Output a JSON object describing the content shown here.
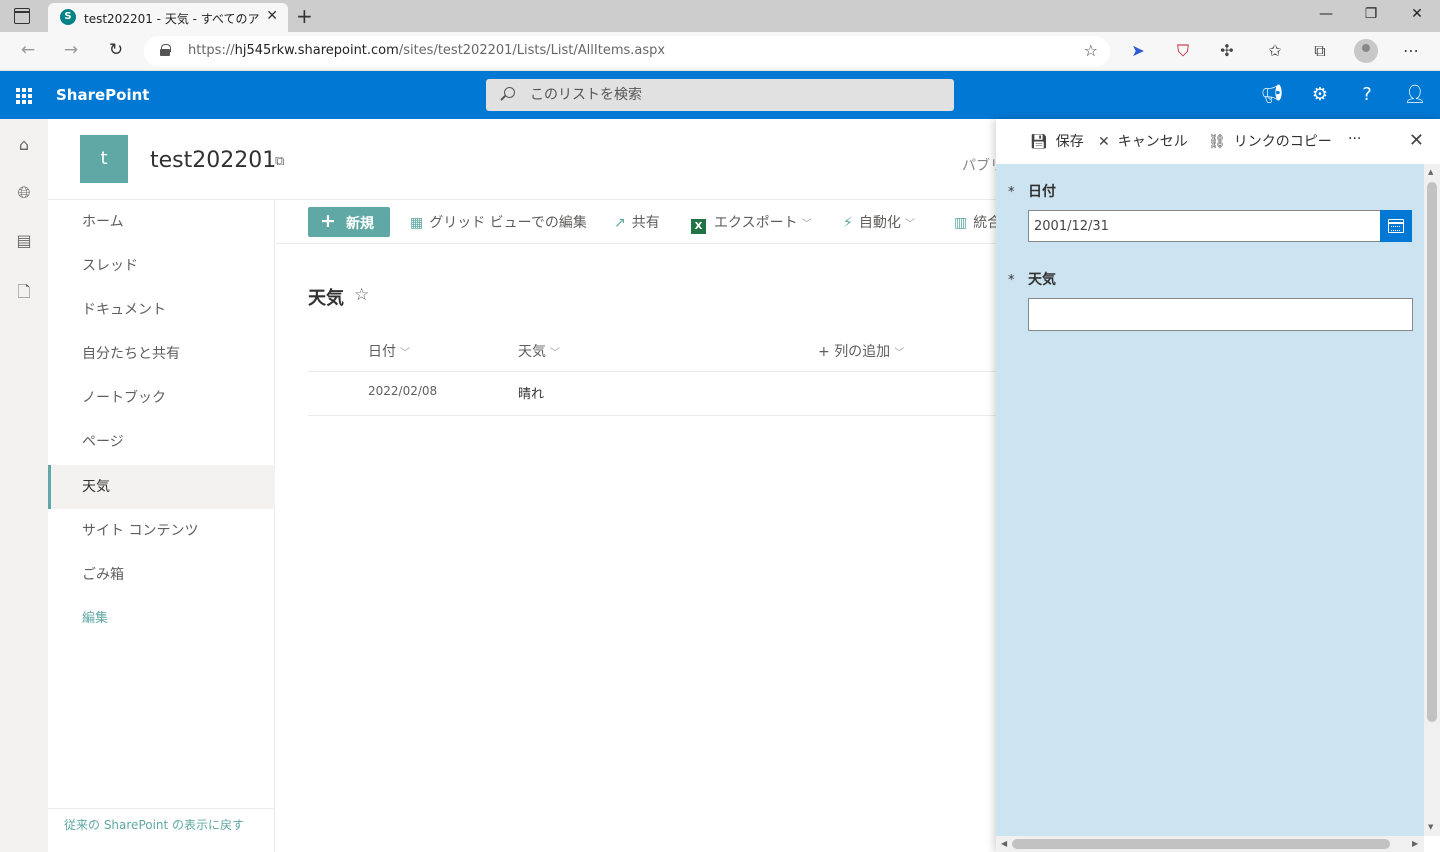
{
  "browser": {
    "tab_title": "test202201 - 天気 - すべてのアイテム",
    "favicon_letter": "S",
    "url_prefix": "https://",
    "url_host": "hj545rkw.sharepoint.com",
    "url_path": "/sites/test202201/Lists/List/AllItems.aspx"
  },
  "suite": {
    "brand": "SharePoint",
    "search_placeholder": "このリストを検索"
  },
  "site": {
    "logo_letter": "t",
    "title": "test202201",
    "privacy": "パブリ"
  },
  "leftnav": {
    "items": [
      {
        "label": "ホーム"
      },
      {
        "label": "スレッド"
      },
      {
        "label": "ドキュメント"
      },
      {
        "label": "自分たちと共有"
      },
      {
        "label": "ノートブック"
      },
      {
        "label": "ページ"
      },
      {
        "label": "天気"
      },
      {
        "label": "サイト コンテンツ"
      },
      {
        "label": "ごみ箱"
      }
    ],
    "edit": "編集",
    "classic_link": "従来の SharePoint の表示に戻す"
  },
  "commandbar": {
    "new": "新規",
    "grid_edit": "グリッド ビューでの編集",
    "share": "共有",
    "export": "エクスポート",
    "automate": "自動化",
    "integrate": "統合"
  },
  "list": {
    "title": "天気",
    "columns": [
      "日付",
      "天気",
      "列の追加"
    ],
    "rows": [
      {
        "date": "2022/02/08",
        "weather": "晴れ"
      }
    ]
  },
  "panel": {
    "save": "保存",
    "cancel": "キャンセル",
    "copy_link": "リンクのコピー",
    "more": "···",
    "required_mark": "*",
    "field_date_label": "日付",
    "field_date_value": "2001/12/31",
    "field_weather_label": "天気",
    "field_weather_value": ""
  },
  "colors": {
    "suite_bar": "#0078d4",
    "accent": "#5fa8a5",
    "panel_bg": "#cce4f2"
  }
}
